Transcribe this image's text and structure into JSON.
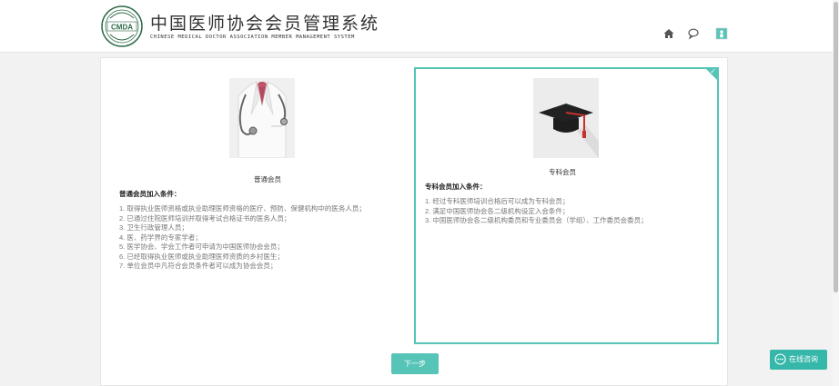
{
  "header": {
    "logo_text": "CMDA",
    "title_cn": "中国医师协会会员管理系统",
    "title_en": "CHINESE MEDICAL DOCTOR ASSOCIATION MEMBER MANAGEMENT SYSTEM",
    "icons": [
      "home-icon",
      "comment-icon",
      "user-icon"
    ]
  },
  "cards": [
    {
      "name": "普通会员",
      "image": "doctor-coat-stethoscope",
      "conditions_title": "普通会员加入条件：",
      "conditions": [
        "1. 取得执业医师资格或执业助理医师资格的医疗、预防、保健机构中的医务人员；",
        "2. 已通过住院医师培训并取得考试合格证书的医务人员；",
        "3. 卫生行政管理人员；",
        "4. 医、药学界的专家学者；",
        "5. 医学协会、学会工作者可申请为中国医师协会会员；",
        "6. 已经取得执业医师或执业助理医师资质的乡村医生；",
        "7. 单位会员中凡符合会员条件者可以成为协会会员；"
      ],
      "selected": false
    },
    {
      "name": "专科会员",
      "image": "graduation-cap",
      "conditions_title": "专科会员加入条件：",
      "conditions": [
        "1. 经过专科医师培训合格后可以成为专科会员；",
        "2. 满足中国医师协会各二级机构设定入会条件；",
        "3. 中国医师协会各二级机构委员和专业委员会（学组）、工作委员会委员；"
      ],
      "selected": true
    }
  ],
  "next_button": "下一步",
  "chat_button": "在线咨询",
  "colors": {
    "accent": "#57c4b8",
    "chat": "#35b7a9",
    "header_bg": "#ffffff",
    "page_bg": "#f2f2f2"
  }
}
